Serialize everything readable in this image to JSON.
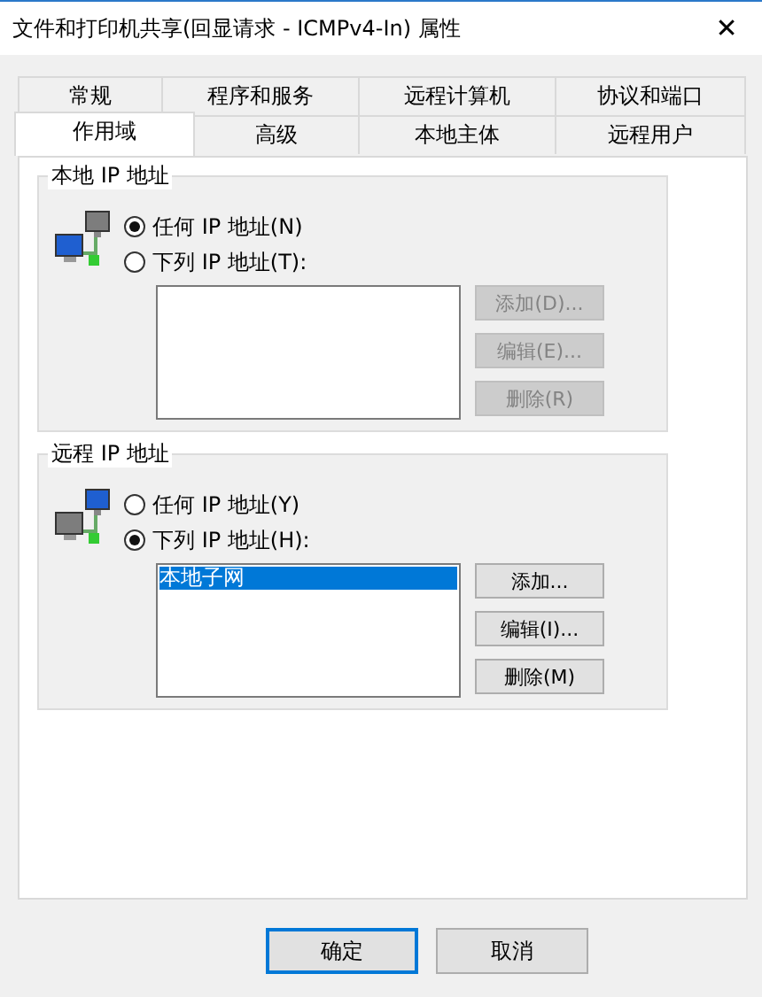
{
  "window": {
    "title": "文件和打印机共享(回显请求 - ICMPv4-In) 属性",
    "close": "✕"
  },
  "tab_rows": [
    [
      {
        "label": "常规",
        "selected": false
      },
      {
        "label": "程序和服务",
        "selected": false
      },
      {
        "label": "远程计算机",
        "selected": false
      },
      {
        "label": "协议和端口",
        "selected": false
      }
    ],
    [
      {
        "label": "作用域",
        "selected": true
      },
      {
        "label": "高级",
        "selected": false
      },
      {
        "label": "本地主体",
        "selected": false
      },
      {
        "label": "远程用户",
        "selected": false
      }
    ]
  ],
  "groups": [
    {
      "title": "本地 IP 地址",
      "kind": "local",
      "radios": [
        {
          "label": "任何 IP 地址(N)",
          "selected": true
        },
        {
          "label": "下列 IP 地址(T):",
          "selected": false
        }
      ],
      "buttons": [
        {
          "label": "添加(D)...",
          "disabled": true
        },
        {
          "label": "编辑(E)...",
          "disabled": true
        },
        {
          "label": "删除(R)",
          "disabled": true
        }
      ]
    },
    {
      "title": "远程 IP 地址",
      "kind": "remote",
      "radios": [
        {
          "label": "任何 IP 地址(Y)",
          "selected": false
        },
        {
          "label": "下列 IP 地址(H):",
          "selected": true
        }
      ],
      "list": [
        {
          "label": "本地子网",
          "selected": true
        }
      ],
      "buttons": [
        {
          "label": "添加...",
          "disabled": false
        },
        {
          "label": "编辑(I)...",
          "disabled": false
        },
        {
          "label": "删除(M)",
          "disabled": false
        }
      ]
    }
  ],
  "footer_buttons": [
    {
      "label": "确定",
      "default": true
    },
    {
      "label": "取消",
      "default": false
    }
  ]
}
